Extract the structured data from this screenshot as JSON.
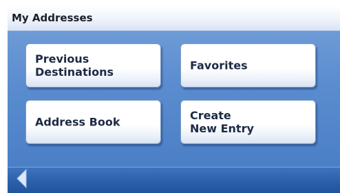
{
  "header": {
    "title": "My Addresses"
  },
  "menu": {
    "previous_destinations": "Previous\nDestinations",
    "favorites": "Favorites",
    "address_book": "Address Book",
    "create_new_entry": "Create\nNew Entry"
  },
  "footer": {
    "back_icon": "back-arrow-icon"
  },
  "colors": {
    "panel": "#5a8ccf",
    "bottom_bar": "#2a5ea8",
    "button_text": "#1d2a44",
    "back_arrow": "#dbe8fa"
  }
}
